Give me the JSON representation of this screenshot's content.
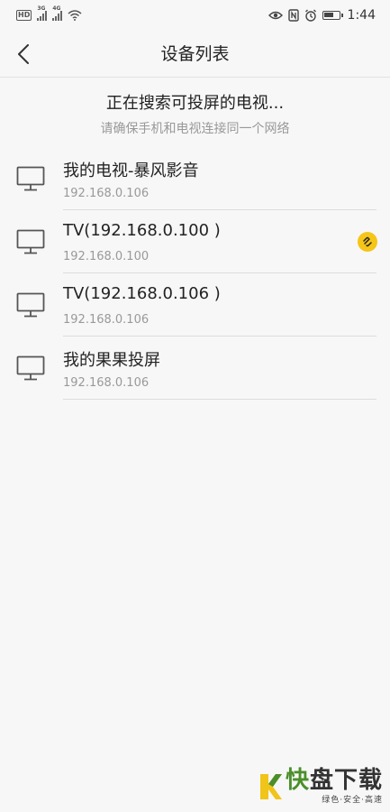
{
  "status_bar": {
    "left_label": "HD",
    "sig1_tag": "3G",
    "sig2_tag": "4G",
    "time": "1:44"
  },
  "header": {
    "title": "设备列表"
  },
  "search": {
    "status_text": "正在搜索可投屏的电视...",
    "hint_text": "请确保手机和电视连接同一个网络"
  },
  "devices": [
    {
      "name": "我的电视-暴风影音",
      "ip": "192.168.0.106",
      "badge": false
    },
    {
      "name": "TV(192.168.0.100 )",
      "ip": "192.168.0.100",
      "badge": true
    },
    {
      "name": "TV(192.168.0.106 )",
      "ip": "192.168.0.106",
      "badge": false
    },
    {
      "name": "我的果果投屏",
      "ip": "192.168.0.106",
      "badge": false
    }
  ],
  "watermark": {
    "title_part1": "快",
    "title_part2": "盘下载",
    "subtitle": "绿色·安全·高速"
  },
  "colors": {
    "background": "#f7f7f7",
    "badge": "#f5c518",
    "watermark_green": "#4a8f2a"
  }
}
